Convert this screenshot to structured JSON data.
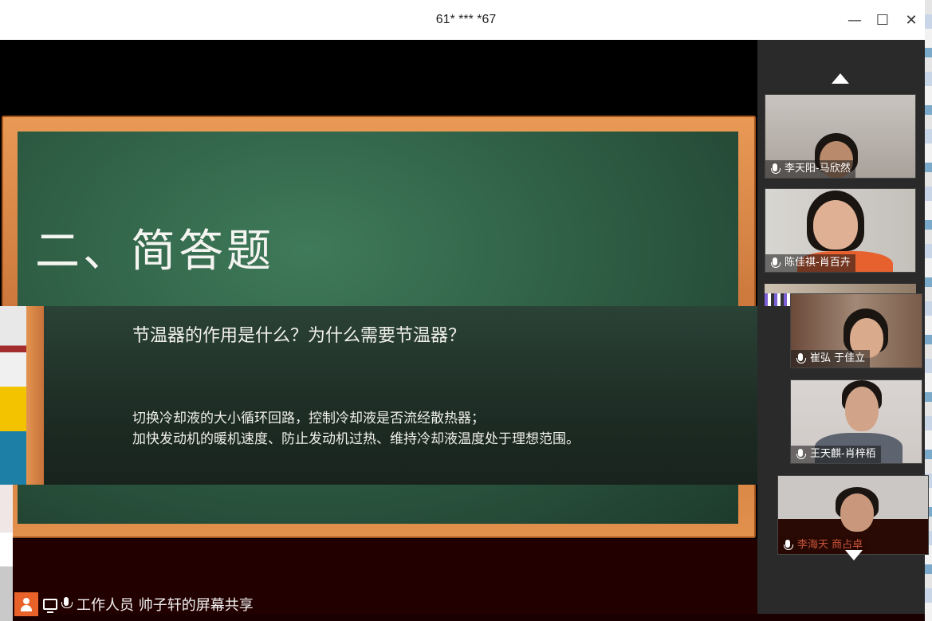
{
  "window": {
    "title": "61* *** *67",
    "minimize_glyph": "—",
    "maximize_glyph": "☐",
    "close_glyph": "✕"
  },
  "slide": {
    "title": "二、简答题",
    "question": "节温器的作用是什么？为什么需要节温器？",
    "answer_lines": [
      "切换冷却液的大小循环回路，控制冷却液是否流经散热器；",
      "加快发动机的暖机速度、防止发动机过热、维持冷却液温度处于理想范围。"
    ]
  },
  "panel": {
    "expand_glyph": "›",
    "participants": [
      {
        "name": "李天阳-马欣然",
        "muted": true
      },
      {
        "name": "陈佳祺-肖百卉",
        "muted": true
      },
      {
        "name": "崔弘 于佳立",
        "muted": true
      },
      {
        "name": "王天麒-肖梓栢",
        "muted": false
      },
      {
        "name": "李海天 商占卓",
        "muted": true
      }
    ]
  },
  "status_bar": {
    "text": "工作人员 帅子轩的屏幕共享"
  },
  "icons": {
    "scroll_up": "triangle-up-icon",
    "scroll_down": "triangle-down-icon"
  },
  "colors": {
    "board_green": "#2f5f45",
    "frame_orange": "#e99a55",
    "avatar_orange": "#e8622a"
  }
}
